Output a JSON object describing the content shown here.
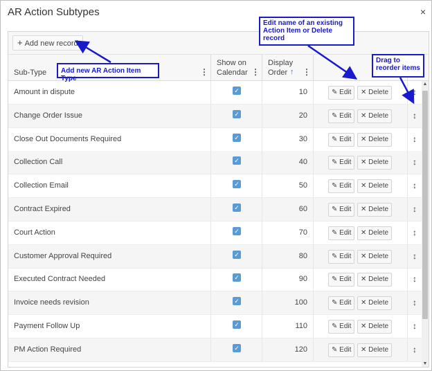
{
  "dialog": {
    "title": "AR Action Subtypes",
    "close_glyph": "×"
  },
  "toolbar": {
    "add_glyph": "+",
    "add_label": "Add new record"
  },
  "columns": {
    "subtype": "Sub-Type",
    "show_line1": "Show on",
    "show_line2": "Calendar",
    "order_line1": "Display",
    "order_line2": "Order",
    "sort_glyph": "↑",
    "menu_glyph": "⋮"
  },
  "row_buttons": {
    "edit_label": "Edit",
    "edit_glyph": "✎",
    "delete_label": "Delete",
    "delete_glyph": "✕",
    "drag_glyph": "↕",
    "check_glyph": "✓"
  },
  "rows": [
    {
      "subtype": "Amount in dispute",
      "show": true,
      "order": "10"
    },
    {
      "subtype": "Change Order Issue",
      "show": true,
      "order": "20"
    },
    {
      "subtype": "Close Out Documents Required",
      "show": true,
      "order": "30"
    },
    {
      "subtype": "Collection Call",
      "show": true,
      "order": "40"
    },
    {
      "subtype": "Collection Email",
      "show": true,
      "order": "50"
    },
    {
      "subtype": "Contract Expired",
      "show": true,
      "order": "60"
    },
    {
      "subtype": "Court Action",
      "show": true,
      "order": "70"
    },
    {
      "subtype": "Customer Approval Required",
      "show": true,
      "order": "80"
    },
    {
      "subtype": "Executed Contract Needed",
      "show": true,
      "order": "90"
    },
    {
      "subtype": "Invoice needs revision",
      "show": true,
      "order": "100"
    },
    {
      "subtype": "Payment Follow Up",
      "show": true,
      "order": "110"
    },
    {
      "subtype": "PM Action Required",
      "show": true,
      "order": "120"
    }
  ],
  "scrollbar": {
    "up_glyph": "▲",
    "down_glyph": "▼"
  },
  "annotations": {
    "add": "Add new AR Action Item Type",
    "edit": "Edit name of an existing Action Item or Delete record",
    "drag": "Drag to reorder items"
  },
  "colors": {
    "annotation": "#1a1acd",
    "checkbox": "#5b9bd5"
  }
}
